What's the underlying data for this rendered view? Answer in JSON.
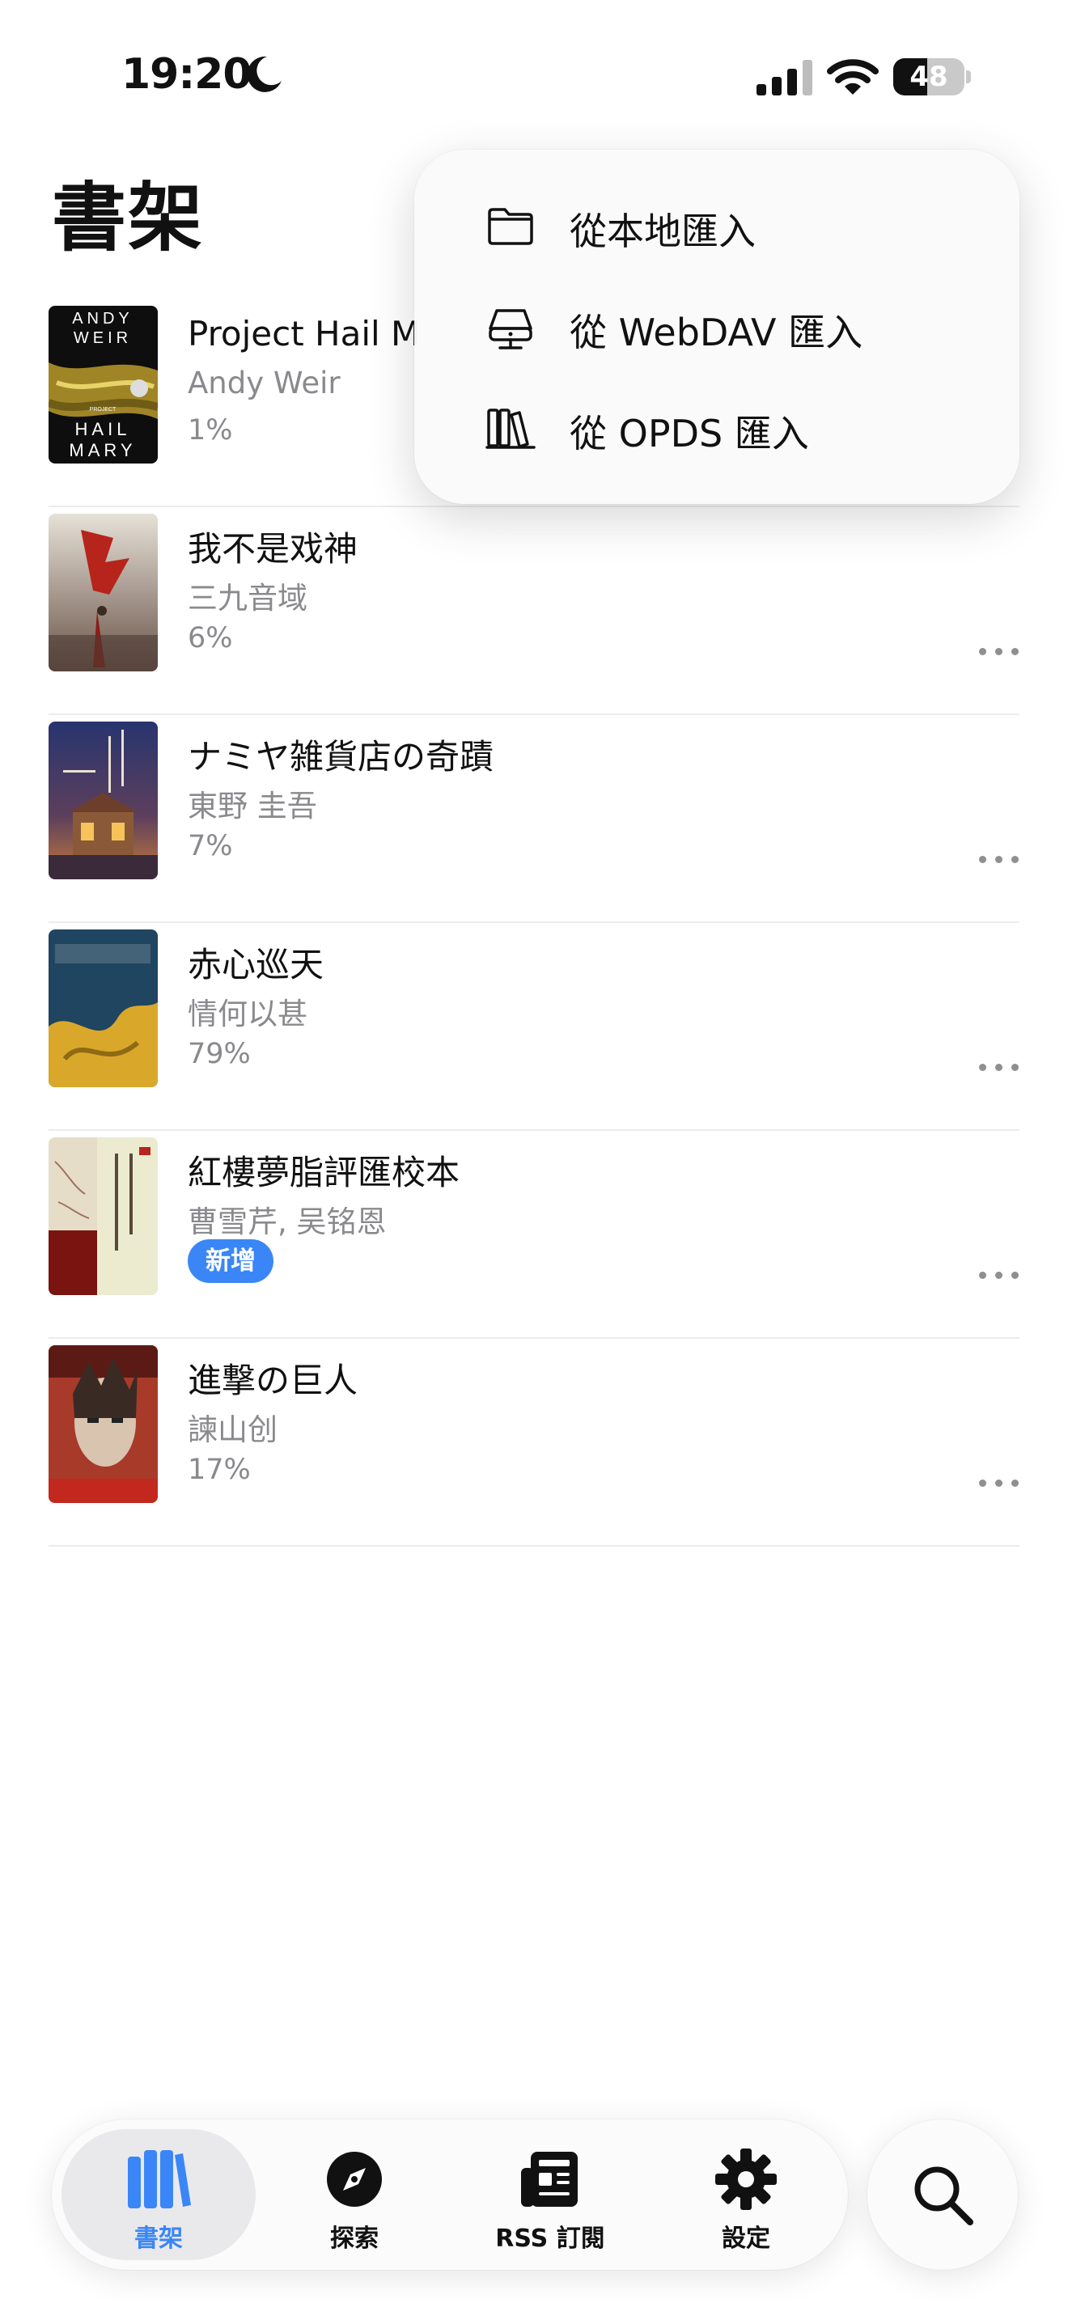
{
  "status_bar": {
    "time": "19:20",
    "battery": "48",
    "battery_level": 0.48
  },
  "header": {
    "title": "書架"
  },
  "menu": {
    "items": [
      {
        "icon": "folder-icon",
        "label": "從本地匯入"
      },
      {
        "icon": "server-icon",
        "label": "從 WebDAV 匯入"
      },
      {
        "icon": "library-icon",
        "label": "從 OPDS 匯入"
      }
    ]
  },
  "books": [
    {
      "title": "Project Hail M",
      "author": "Andy Weir",
      "progress": "1%"
    },
    {
      "title": "我不是戏神",
      "author": "三九音域",
      "progress": "6%"
    },
    {
      "title": "ナミヤ雑貨店の奇蹟",
      "author": "東野 圭吾",
      "progress": "7%"
    },
    {
      "title": "赤心巡天",
      "author": "情何以甚",
      "progress": "79%"
    },
    {
      "title": "紅樓夢脂評匯校本",
      "author": "曹雪芹, 吴铭恩",
      "badge": "新增"
    },
    {
      "title": "進撃の巨人",
      "author": "諫山创",
      "progress": "17%"
    }
  ],
  "covers": {
    "hail_mary": [
      "ANDY",
      "WEIR",
      "PROJECT",
      "HAIL",
      "MARY"
    ]
  },
  "tabs": [
    {
      "label": "書架",
      "icon": "bookshelf-icon",
      "active": true
    },
    {
      "label": "探索",
      "icon": "compass-icon"
    },
    {
      "label": "RSS 訂閱",
      "icon": "newspaper-icon"
    },
    {
      "label": "設定",
      "icon": "gear-icon"
    }
  ],
  "colors": {
    "accent": "#3b86f6",
    "secondary_text": "#8a8a8e"
  }
}
